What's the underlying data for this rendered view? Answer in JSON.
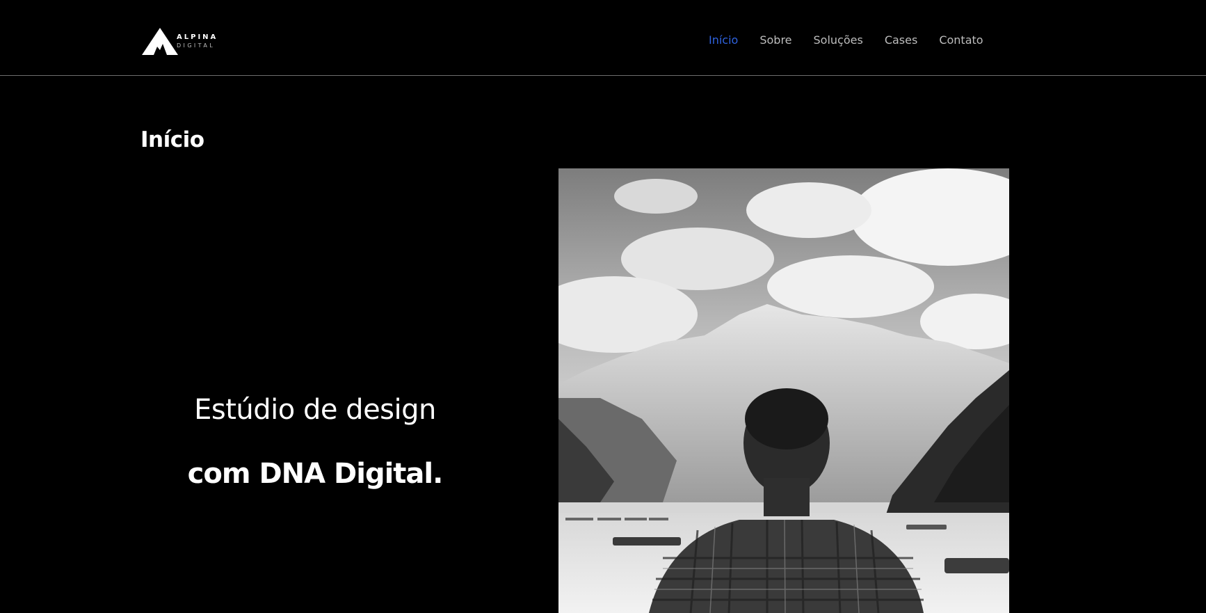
{
  "brand": {
    "name_line1": "ALPINA",
    "name_line2": "DIGITAL"
  },
  "nav": {
    "items": [
      {
        "label": "Início",
        "active": true
      },
      {
        "label": "Sobre",
        "active": false
      },
      {
        "label": "Soluções",
        "active": false
      },
      {
        "label": "Cases",
        "active": false
      },
      {
        "label": "Contato",
        "active": false
      }
    ]
  },
  "page": {
    "title": "Início"
  },
  "hero": {
    "line1": "Estúdio de design",
    "line2": "com DNA Digital."
  },
  "image": {
    "alt": "Photo of a man facing a mountain lake with boats"
  },
  "colors": {
    "background": "#000000",
    "accent": "#2f63e0",
    "nav_text": "#bdbdbd",
    "divider": "#6e6e6e"
  }
}
